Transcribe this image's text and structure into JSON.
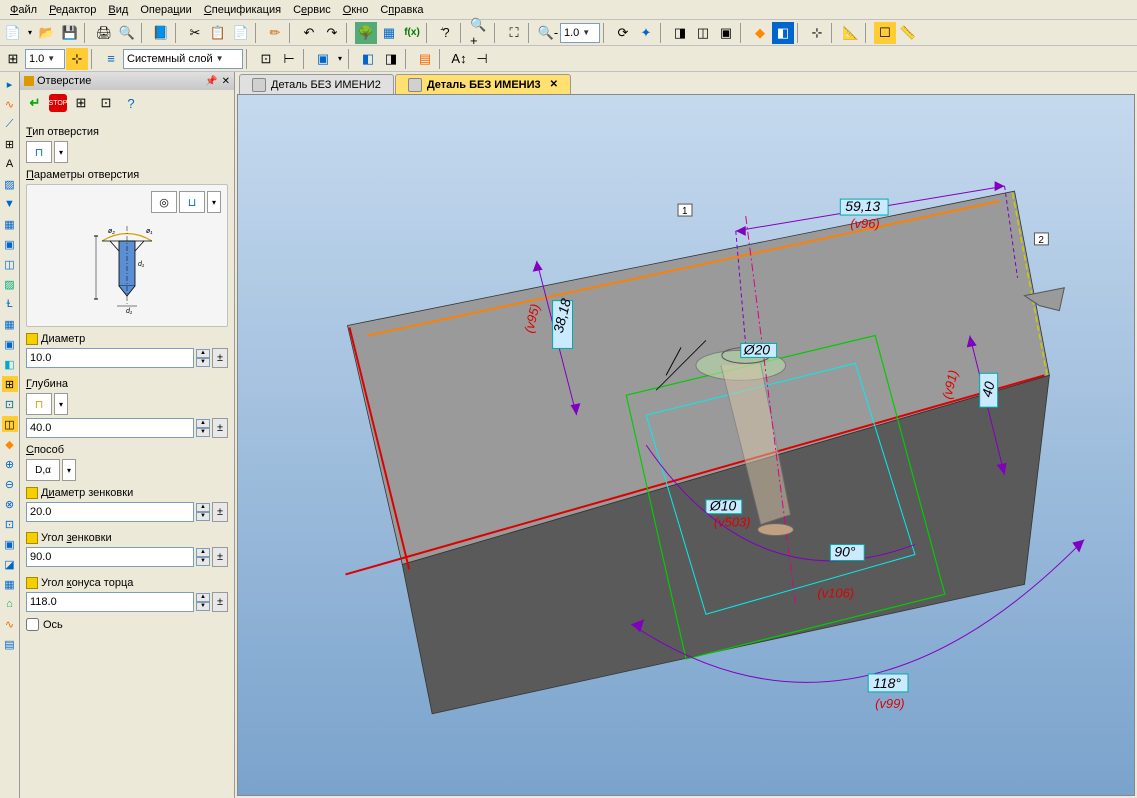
{
  "menu": {
    "items": [
      "Файл",
      "Редактор",
      "Вид",
      "Операции",
      "Спецификация",
      "Сервис",
      "Окно",
      "Справка"
    ]
  },
  "toolbar1": {
    "zoom": "1.0"
  },
  "toolbar2": {
    "scale": "1.0",
    "layer": "Системный слой"
  },
  "panel": {
    "title": "Отверстие",
    "type_label": "Тип отверстия",
    "params_label": "Параметры отверстия",
    "axis_label": "Ось",
    "fields": {
      "diameter": {
        "label": "Диаметр",
        "value": "10.0"
      },
      "depth": {
        "label": "Глубина",
        "value": "40.0"
      },
      "method": {
        "label": "Способ",
        "value": "D,α"
      },
      "csDiameter": {
        "label": "Диаметр зенковки",
        "value": "20.0"
      },
      "csAngle": {
        "label": "Угол зенковки",
        "value": "90.0"
      },
      "tipAngle": {
        "label": "Угол конуса торца",
        "value": "118.0"
      }
    }
  },
  "tabs": [
    {
      "label": "Деталь БЕЗ ИМЕНИ2",
      "active": false
    },
    {
      "label": "Деталь БЕЗ ИМЕНИ3",
      "active": true
    }
  ],
  "dimensions": {
    "d1": {
      "value": "59,13",
      "var": "(v96)"
    },
    "d2": {
      "value": "38,18",
      "var": "(v95)"
    },
    "d3": {
      "value": "40",
      "var": "(v91)"
    },
    "d4": {
      "value": "Ø20",
      "var": ""
    },
    "d5": {
      "value": "Ø10",
      "var": "(v503)"
    },
    "d6": {
      "value": "90°",
      "var": "(v106)"
    },
    "d7": {
      "value": "118°",
      "var": "(v99)"
    },
    "m1": "1",
    "m2": "2"
  }
}
